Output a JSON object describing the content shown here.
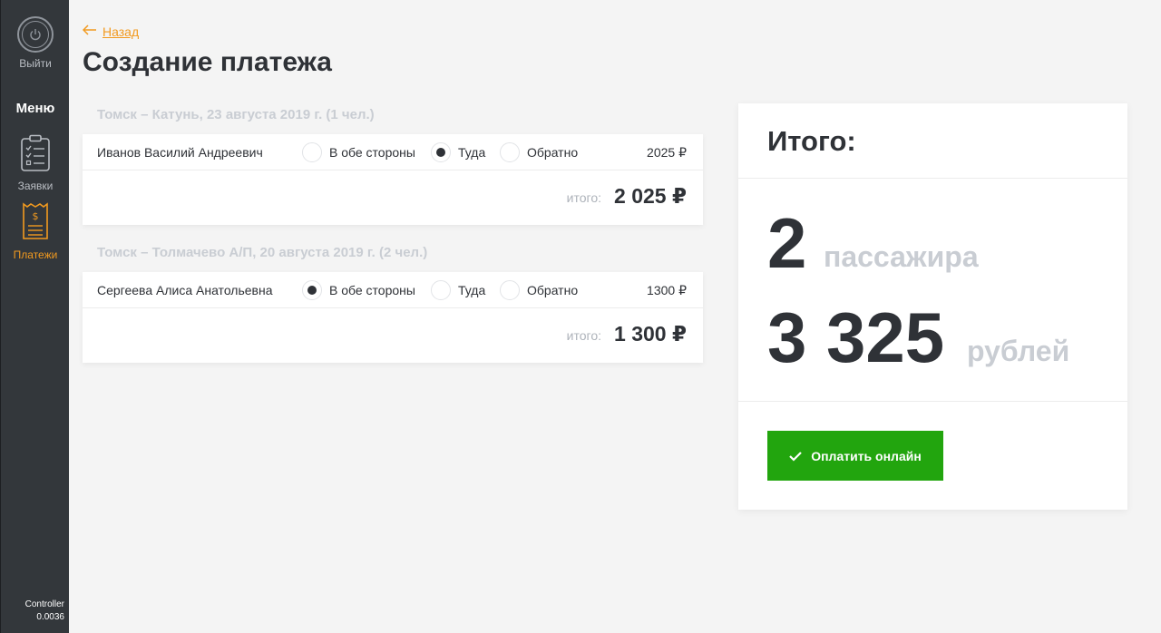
{
  "sidebar": {
    "logout_label": "Выйти",
    "menu_title": "Меню",
    "orders_label": "Заявки",
    "payments_label": "Платежи",
    "version_line1": "Controller",
    "version_line2": "0.0036"
  },
  "header": {
    "back_label": "Назад",
    "title": "Создание платежа"
  },
  "groups": [
    {
      "title": "Томск – Катунь, 23 августа 2019 г. (1 чел.)",
      "passengers": [
        {
          "name": "Иванов Василий Андреевич",
          "options": [
            "В обе стороны",
            "Туда",
            "Обратно"
          ],
          "selected": "Туда",
          "price": "2025 ₽"
        }
      ],
      "total_label": "итого:",
      "total_value": "2 025 ₽"
    },
    {
      "title": "Томск – Толмачево А/П, 20 августа 2019 г. (2 чел.)",
      "passengers": [
        {
          "name": "Сергеева Алиса Анатольевна",
          "options": [
            "В обе стороны",
            "Туда",
            "Обратно"
          ],
          "selected": "В обе стороны",
          "price": "1300 ₽"
        }
      ],
      "total_label": "итого:",
      "total_value": "1 300 ₽"
    }
  ],
  "summary": {
    "title": "Итого:",
    "passengers_count": "2",
    "passengers_unit": "пассажира",
    "amount": "3 325",
    "amount_unit": "рублей",
    "pay_label": "Оплатить онлайн"
  },
  "colors": {
    "accent": "#f29a1f",
    "pay": "#22a50e",
    "sidebar": "#33373b"
  }
}
